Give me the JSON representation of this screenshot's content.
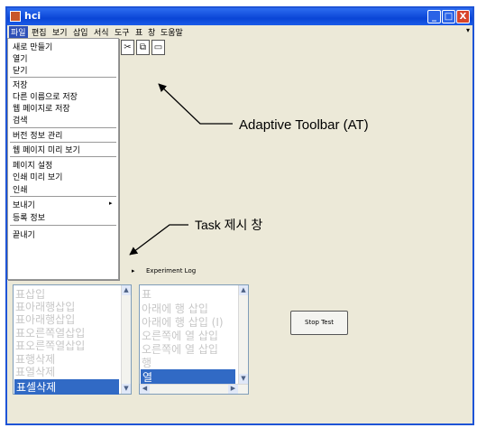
{
  "window": {
    "title": "hci"
  },
  "titlebar_buttons": {
    "minimize": "_",
    "maximize": "□",
    "close": "X"
  },
  "menubar": {
    "items": [
      "파일",
      "편집",
      "보기",
      "삽입",
      "서식",
      "도구",
      "표",
      "창",
      "도움말"
    ],
    "overflow_arrow": "▾"
  },
  "file_menu": {
    "items": [
      "새로 만들기",
      "열기",
      "닫기",
      "저장",
      "다른 이름으로 저장",
      "웹 페이지로 저장",
      "검색",
      "버전 정보 관리",
      "웹 페이지 미리 보기",
      "페이지 설정",
      "인쇄 미리 보기",
      "인쇄",
      "보내기",
      "등록 정보",
      "끝내기"
    ],
    "submenu_arrow": "▸"
  },
  "toolbar": {
    "icons": [
      "scissors-icon",
      "copy-icon",
      "window-icon"
    ]
  },
  "annotations": {
    "adaptive_toolbar": "Adaptive Toolbar (AT)",
    "task_window": "Task 제시 창"
  },
  "experiment_log": {
    "label": "Experiment Log",
    "bullet": "▸"
  },
  "list1": {
    "items": [
      "표삽입",
      "표아래행삽입",
      "표아래행삽입",
      "표오른쪽열삽입",
      "표오른쪽열삽입",
      "표행삭제",
      "표열삭제",
      "표셀삭제"
    ],
    "selected_index": 7
  },
  "list2": {
    "items": [
      "표",
      "아래에 행 삽입",
      "아래에 행 삽입 (I)",
      "오른쪽에 열 삽입",
      "오른쪽에 열 삽입",
      "행",
      "열"
    ],
    "selected_index": 6
  },
  "scroll_arrows": {
    "up": "▲",
    "down": "▼",
    "left": "◀",
    "right": "▶"
  },
  "stop_button": {
    "label": "Stop Test"
  },
  "colors": {
    "titlebar": "#0a45d6",
    "selection": "#316ac5",
    "close_button": "#d8452a"
  }
}
